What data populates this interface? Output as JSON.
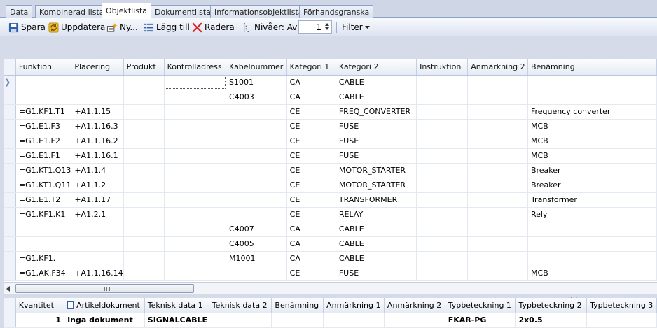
{
  "tabs": [
    "Data",
    "Kombinerad lista",
    "Objektlista",
    "Dokumentlista",
    "Informationsobjektlista",
    "Förhandsgranska"
  ],
  "active_tab": "Objektlista",
  "toolbar": {
    "save_label": "Spara",
    "update_label": "Uppdatera",
    "new_label": "Ny...",
    "add_label": "Lägg till",
    "delete_label": "Radera",
    "levels_label": "Nivåer: Av",
    "levels_value": "1",
    "filter_label": "Filter"
  },
  "grid": {
    "columns": [
      "Funktion",
      "Placering",
      "Produkt",
      "Kontrolladress",
      "Kabelnummer",
      "Kategori 1",
      "Kategori 2",
      "Instruktion",
      "Anmärkning 2",
      "Benämning"
    ],
    "rows": [
      [
        "",
        "",
        "",
        "",
        "S1001",
        "CA",
        "CABLE",
        "",
        "",
        ""
      ],
      [
        "",
        "",
        "",
        "",
        "C4003",
        "CA",
        "CABLE",
        "",
        "",
        ""
      ],
      [
        "=G1.KF1.T1",
        "+A1.1.15",
        "",
        "",
        "",
        "CE",
        "FREQ_CONVERTER",
        "",
        "",
        "Frequency converter"
      ],
      [
        "=G1.E1.F3",
        "+A1.1.16.3",
        "",
        "",
        "",
        "CE",
        "FUSE",
        "",
        "",
        "MCB"
      ],
      [
        "=G1.E1.F2",
        "+A1.1.16.2",
        "",
        "",
        "",
        "CE",
        "FUSE",
        "",
        "",
        "MCB"
      ],
      [
        "=G1.E1.F1",
        "+A1.1.16.1",
        "",
        "",
        "",
        "CE",
        "FUSE",
        "",
        "",
        "MCB"
      ],
      [
        "=G1.KT1.Q13",
        "+A1.1.4",
        "",
        "",
        "",
        "CE",
        "MOTOR_STARTER",
        "",
        "",
        "Breaker"
      ],
      [
        "=G1.KT1.Q11",
        "+A1.1.2",
        "",
        "",
        "",
        "CE",
        "MOTOR_STARTER",
        "",
        "",
        "Breaker"
      ],
      [
        "=G1.E1.T2",
        "+A1.1.17",
        "",
        "",
        "",
        "CE",
        "TRANSFORMER",
        "",
        "",
        "Transformer"
      ],
      [
        "=G1.KF1.K1",
        "+A1.2.1",
        "",
        "",
        "",
        "CE",
        "RELAY",
        "",
        "",
        "Rely"
      ],
      [
        "",
        "",
        "",
        "",
        "C4007",
        "CA",
        "CABLE",
        "",
        "",
        ""
      ],
      [
        "",
        "",
        "",
        "",
        "C4005",
        "CA",
        "CABLE",
        "",
        "",
        ""
      ],
      [
        "=G1.KF1.",
        "",
        "",
        "",
        "M1001",
        "CA",
        "CABLE",
        "",
        "",
        ""
      ],
      [
        "=G1.AK.F34",
        "+A1.1.16.14",
        "",
        "",
        "",
        "CE",
        "FUSE",
        "",
        "",
        "MCB"
      ]
    ]
  },
  "detail": {
    "columns": [
      "Kvantitet",
      "Artikeldokument",
      "Teknisk data 1",
      "Teknisk data 2",
      "Benämning",
      "Anmärkning 1",
      "Anmärkning 2",
      "Typbeteckning 1",
      "Typbeteckning 2",
      "Typbeteckning 3"
    ],
    "row": [
      "1",
      "Inga dokument",
      "SIGNALCABLE",
      "",
      "",
      "",
      "",
      "FKAR-PG",
      "2x0.5",
      ""
    ]
  }
}
